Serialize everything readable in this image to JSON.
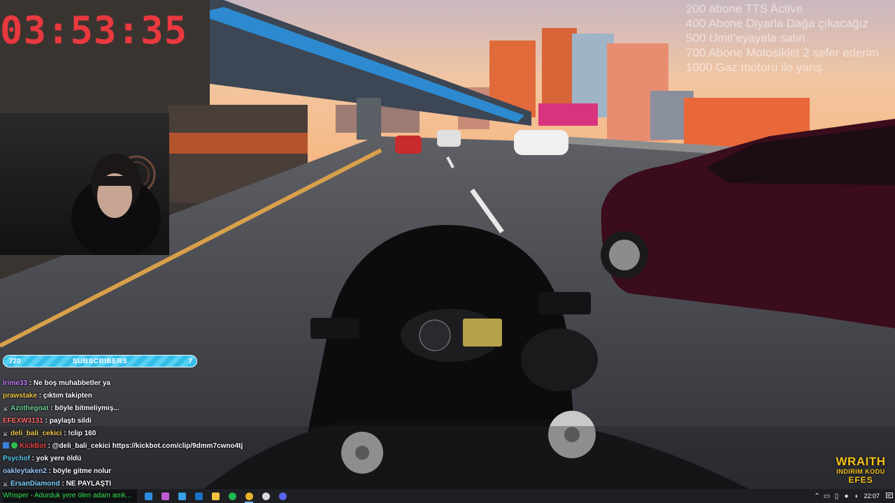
{
  "stream": {
    "timer": "03:53:35",
    "goals": [
      "200 abone TTS Active",
      "400 Abone Diyarla Dağa çıkacağız",
      "500 Umit'eyayala satiri",
      "700 Abone Motosiklet 2 sefer ederim",
      "1000 Gaz motoru ile yarış"
    ]
  },
  "subscriber_bar": {
    "count_left": "720",
    "label": "SUBSCRIBERS",
    "count_right": "7",
    "color": "#35bde8"
  },
  "chat": {
    "messages": [
      {
        "user": "Irime33",
        "text": " : Ne boş muhabbetler ya",
        "color": "#c77dff",
        "badge": ""
      },
      {
        "user": "prawstake",
        "text": " : çıktım takipten",
        "color": "#f2c94c",
        "badge": ""
      },
      {
        "user": "Azothegoat",
        "text": " : böyle bitmeliymiş...",
        "color": "#6fcf97",
        "badge": "sword-icon"
      },
      {
        "user": "EFEXW3131",
        "text": " : paylaştı sildi",
        "color": "#ff6b6b",
        "badge": ""
      },
      {
        "user": "deli_bali_cekici",
        "text": " : !clip 160",
        "color": "#f2c94c",
        "badge": "sword-icon"
      },
      {
        "user": "KickBot",
        "text": " : @deli_bali_cekici https://kickbot.com/clip/9dmm7cwno4tj",
        "color": "#e84545",
        "badge": "bot-icon"
      },
      {
        "user": "Psychof",
        "text": " : yok yere öldü",
        "color": "#56ccf2",
        "badge": ""
      },
      {
        "user": "oakleytaken2",
        "text": " : böyle gitme nolur",
        "color": "#9ecbff",
        "badge": ""
      },
      {
        "user": "ErsanDiamond",
        "text": " : NE PAYLAŞTI",
        "color": "#7fd3ff",
        "badge": "sword-icon"
      }
    ]
  },
  "sponsor": {
    "brand": "WRAITH",
    "line2": "INDIRIM KODU",
    "code": "EFES",
    "color": "#f6c219"
  },
  "taskbar": {
    "preview_text": "Whisper - Adurduk yere ölen adam amk...",
    "apps": [
      {
        "name": "edge-icon",
        "color": "#2f8ee0"
      },
      {
        "name": "copilot-icon",
        "color": "#c05bd6"
      },
      {
        "name": "store-icon",
        "color": "#3aa0e8"
      },
      {
        "name": "outlook-icon",
        "color": "#1a73c7"
      },
      {
        "name": "file-explorer-icon",
        "color": "#f4c23d"
      },
      {
        "name": "spotify-icon",
        "color": "#1db954"
      },
      {
        "name": "chrome-icon",
        "color": "#e8b32e"
      },
      {
        "name": "obs-icon",
        "color": "#d8d8d8"
      },
      {
        "name": "discord-icon",
        "color": "#5865f2"
      }
    ],
    "active_app": "chrome-icon",
    "clock": "22:07"
  }
}
